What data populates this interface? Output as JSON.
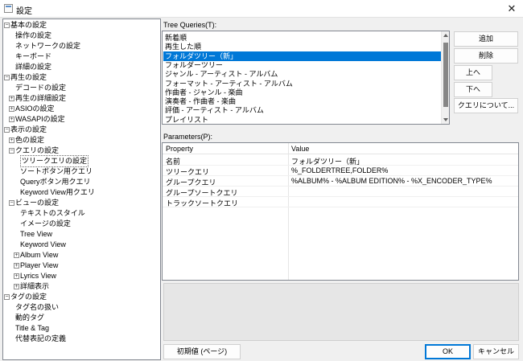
{
  "window": {
    "title": "設定",
    "close_glyph": "✕",
    "icon": "settings-app-icon"
  },
  "tree": {
    "rows": [
      {
        "label": "基本の設定",
        "level": 0,
        "expander": "−"
      },
      {
        "label": "操作の設定",
        "level": 1,
        "expander": ""
      },
      {
        "label": "ネットワークの設定",
        "level": 1,
        "expander": ""
      },
      {
        "label": "キーボード",
        "level": 1,
        "expander": ""
      },
      {
        "label": "詳細の設定",
        "level": 1,
        "expander": ""
      },
      {
        "label": "再生の設定",
        "level": 0,
        "expander": "−"
      },
      {
        "label": "デコードの設定",
        "level": 1,
        "expander": ""
      },
      {
        "label": "再生の詳細設定",
        "level": 1,
        "expander": "+"
      },
      {
        "label": "ASIOの設定",
        "level": 1,
        "expander": "+"
      },
      {
        "label": "WASAPIの設定",
        "level": 1,
        "expander": "+"
      },
      {
        "label": "表示の設定",
        "level": 0,
        "expander": "−"
      },
      {
        "label": "色の設定",
        "level": 1,
        "expander": "+"
      },
      {
        "label": "クエリの設定",
        "level": 1,
        "expander": "−"
      },
      {
        "label": "ツリークエリの設定",
        "level": 2,
        "expander": "",
        "selected": true
      },
      {
        "label": "ソートボタン用クエリ",
        "level": 2,
        "expander": ""
      },
      {
        "label": "Queryボタン用クエリ",
        "level": 2,
        "expander": ""
      },
      {
        "label": "Keyword View用クエリ",
        "level": 2,
        "expander": ""
      },
      {
        "label": "ビューの設定",
        "level": 1,
        "expander": "−"
      },
      {
        "label": "テキストのスタイル",
        "level": 2,
        "expander": ""
      },
      {
        "label": "イメージの設定",
        "level": 2,
        "expander": ""
      },
      {
        "label": "Tree View",
        "level": 2,
        "expander": ""
      },
      {
        "label": "Keyword View",
        "level": 2,
        "expander": ""
      },
      {
        "label": "Album View",
        "level": 2,
        "expander": "+"
      },
      {
        "label": "Player View",
        "level": 2,
        "expander": "+"
      },
      {
        "label": "Lyrics View",
        "level": 2,
        "expander": "+"
      },
      {
        "label": "詳細表示",
        "level": 2,
        "expander": "+"
      },
      {
        "label": "タグの設定",
        "level": 0,
        "expander": "−"
      },
      {
        "label": "タグ名の扱い",
        "level": 1,
        "expander": ""
      },
      {
        "label": "動的タグ",
        "level": 1,
        "expander": ""
      },
      {
        "label": "Title & Tag",
        "level": 1,
        "expander": ""
      },
      {
        "label": "代替表記の定義",
        "level": 1,
        "expander": ""
      }
    ]
  },
  "queries": {
    "label": "Tree Queries(T):",
    "items": [
      {
        "label": "新着順"
      },
      {
        "label": "再生した順"
      },
      {
        "label": "フォルダツリー（新」",
        "selected": true
      },
      {
        "label": "フォルダーツリー"
      },
      {
        "label": "ジャンル - アーティスト - アルバム"
      },
      {
        "label": "フォーマット - アーティスト - アルバム"
      },
      {
        "label": "作曲者 - ジャンル - 楽曲"
      },
      {
        "label": "演奏者 - 作曲者 - 楽曲"
      },
      {
        "label": "評価 - アーティスト - アルバム"
      },
      {
        "label": "プレイリスト"
      }
    ]
  },
  "side_buttons": {
    "add": "追加",
    "delete": "削除",
    "up": "上へ",
    "down": "下へ",
    "about": "クエリについて..."
  },
  "parameters": {
    "label": "Parameters(P):",
    "headers": {
      "property": "Property",
      "value": "Value"
    },
    "rows": [
      {
        "property": "名前",
        "value": "フォルダツリー（新」"
      },
      {
        "property": "ツリークエリ",
        "value": "%_FOLDERTREE,FOLDER%"
      },
      {
        "property": "グループクエリ",
        "value": "%ALBUM% - %ALBUM EDITION% - %X_ENCODER_TYPE%"
      },
      {
        "property": "グループソートクエリ",
        "value": ""
      },
      {
        "property": "トラックソートクエリ",
        "value": ""
      }
    ]
  },
  "footer": {
    "reset": "初期値 (ページ)",
    "ok": "OK",
    "cancel": "キャンセル"
  }
}
